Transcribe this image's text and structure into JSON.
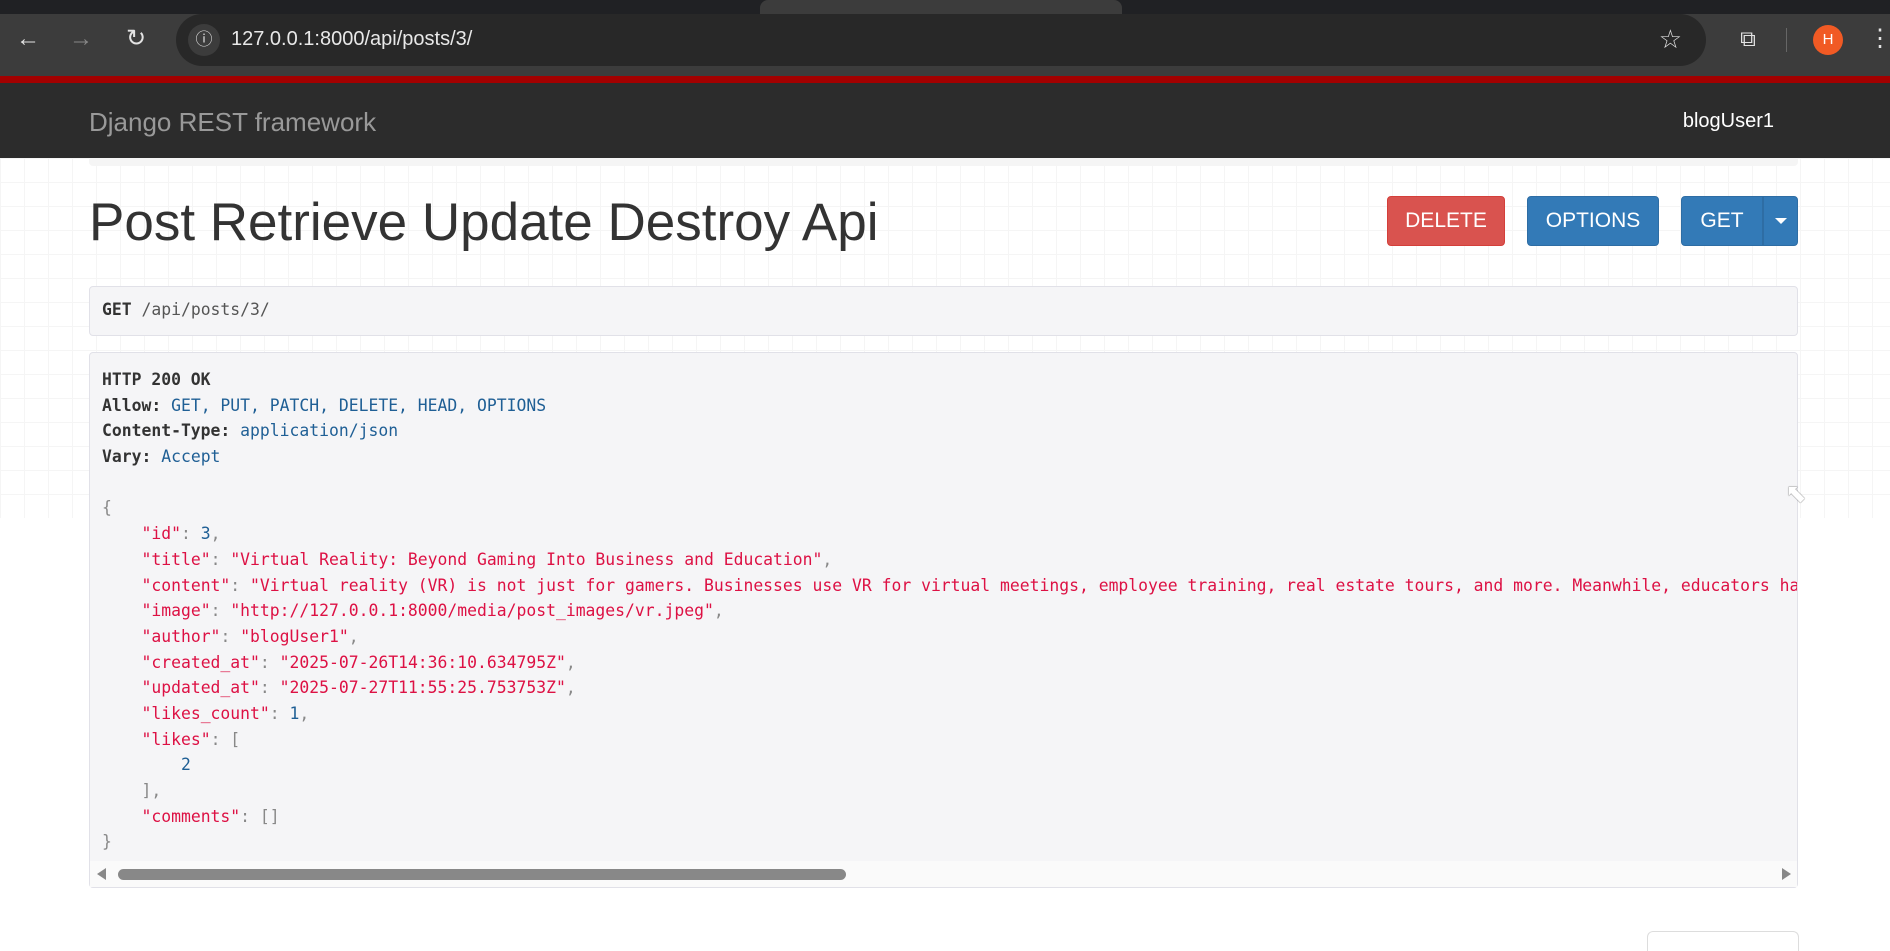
{
  "browser": {
    "url": "127.0.0.1:8000/api/posts/3/",
    "profile_initial": "H"
  },
  "navbar": {
    "brand": "Django REST framework",
    "user": "blogUser1"
  },
  "page": {
    "title": "Post Retrieve Update Destroy Api"
  },
  "buttons": {
    "delete": "DELETE",
    "options": "OPTIONS",
    "get": "GET"
  },
  "request": {
    "method": "GET",
    "path": "/api/posts/3/"
  },
  "response": {
    "status": "HTTP 200 OK",
    "headers": [
      {
        "name": "Allow:",
        "value": "GET, PUT, PATCH, DELETE, HEAD, OPTIONS"
      },
      {
        "name": "Content-Type:",
        "value": "application/json"
      },
      {
        "name": "Vary:",
        "value": "Accept"
      }
    ],
    "body": {
      "id": "3",
      "title": "\"Virtual Reality: Beyond Gaming Into Business and Education\"",
      "content": "\"Virtual reality (VR) is not just for gamers. Businesses use VR for virtual meetings, employee training, real estate tours, and more. Meanwhile, educators ha",
      "image": "\"http://127.0.0.1:8000/media/post_images/vr.jpeg\"",
      "author": "\"blogUser1\"",
      "created_at": "\"2025-07-26T14:36:10.634795Z\"",
      "updated_at": "\"2025-07-27T11:55:25.753753Z\"",
      "likes_count": "1",
      "likes": [
        "2"
      ],
      "comments": "[]"
    },
    "keys": {
      "id": "\"id\"",
      "title": "\"title\"",
      "content": "\"content\"",
      "image": "\"image\"",
      "author": "\"author\"",
      "created_at": "\"created_at\"",
      "updated_at": "\"updated_at\"",
      "likes_count": "\"likes_count\"",
      "likes": "\"likes\"",
      "comments": "\"comments\""
    }
  }
}
